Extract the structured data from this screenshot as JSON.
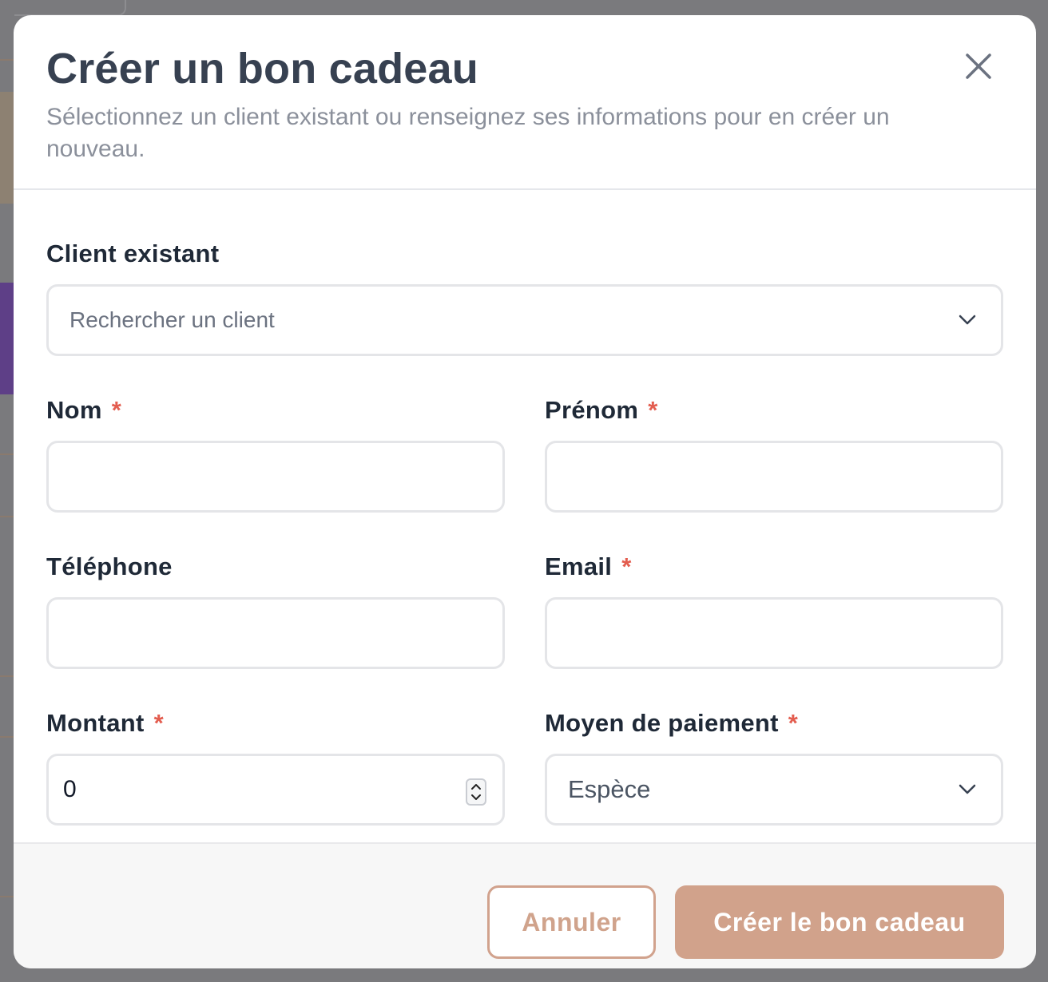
{
  "modal": {
    "title": "Créer un bon cadeau",
    "subtitle": "Sélectionnez un client existant ou renseignez ses informations pour en créer un nouveau.",
    "close_icon": "close-icon"
  },
  "form": {
    "existing_client": {
      "label": "Client existant",
      "placeholder": "Rechercher un client"
    },
    "nom": {
      "label": "Nom",
      "required": "*",
      "value": ""
    },
    "prenom": {
      "label": "Prénom",
      "required": "*",
      "value": ""
    },
    "telephone": {
      "label": "Téléphone",
      "value": ""
    },
    "email": {
      "label": "Email",
      "required": "*",
      "value": ""
    },
    "montant": {
      "label": "Montant",
      "required": "*",
      "value": "0"
    },
    "moyen_paiement": {
      "label": "Moyen de paiement",
      "required": "*",
      "selected": "Espèce"
    }
  },
  "footer": {
    "cancel_label": "Annuler",
    "submit_label": "Créer le bon cadeau"
  },
  "colors": {
    "accent": "#d1a28b",
    "required": "#e35d4f",
    "title": "#374151"
  }
}
